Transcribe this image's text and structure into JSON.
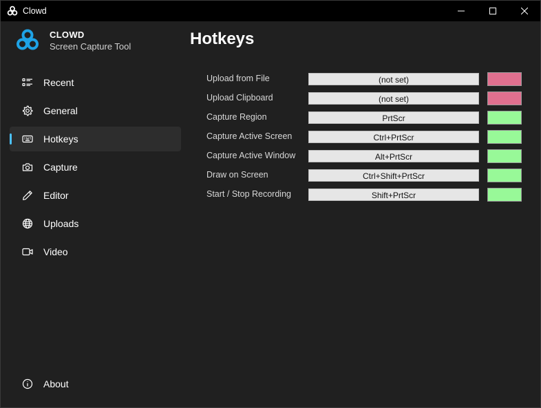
{
  "window": {
    "title": "Clowd",
    "icon": "clowd-logo-icon"
  },
  "brand": {
    "name": "CLOWD",
    "subtitle": "Screen Capture Tool",
    "color": "#1ea3e6"
  },
  "nav": {
    "accent": "#4cc2ff",
    "items": [
      {
        "label": "Recent",
        "icon": "list-icon",
        "active": false
      },
      {
        "label": "General",
        "icon": "gear-icon",
        "active": false
      },
      {
        "label": "Hotkeys",
        "icon": "keyboard-icon",
        "active": true
      },
      {
        "label": "Capture",
        "icon": "camera-icon",
        "active": false
      },
      {
        "label": "Editor",
        "icon": "pencil-icon",
        "active": false
      },
      {
        "label": "Uploads",
        "icon": "globe-icon",
        "active": false
      },
      {
        "label": "Video",
        "icon": "video-icon",
        "active": false
      }
    ],
    "about": {
      "label": "About",
      "icon": "info-icon"
    }
  },
  "page": {
    "title": "Hotkeys"
  },
  "status_colors": {
    "unset": "#e0708f",
    "set": "#98f998"
  },
  "hotkeys": [
    {
      "label": "Upload from File",
      "value": "(not set)",
      "status": "unset"
    },
    {
      "label": "Upload Clipboard",
      "value": "(not set)",
      "status": "unset"
    },
    {
      "label": "Capture Region",
      "value": "PrtScr",
      "status": "set"
    },
    {
      "label": "Capture Active Screen",
      "value": "Ctrl+PrtScr",
      "status": "set"
    },
    {
      "label": "Capture Active Window",
      "value": "Alt+PrtScr",
      "status": "set"
    },
    {
      "label": "Draw on Screen",
      "value": "Ctrl+Shift+PrtScr",
      "status": "set"
    },
    {
      "label": "Start / Stop Recording",
      "value": "Shift+PrtScr",
      "status": "set"
    }
  ]
}
